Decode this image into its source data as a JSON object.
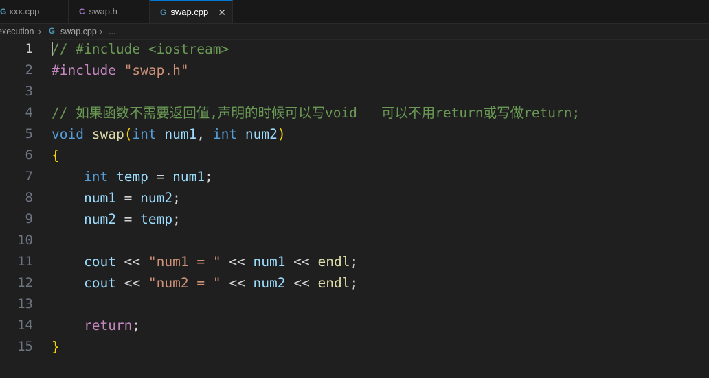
{
  "tabs": [
    {
      "label": "xxx.cpp",
      "icon": "cpp-file-icon",
      "icon_glyph": "G",
      "icon_color": "#519aba"
    },
    {
      "label": "swap.h",
      "icon": "c-header-file-icon",
      "icon_glyph": "C",
      "icon_color": "#a074c4"
    },
    {
      "label": "swap.cpp",
      "icon": "cpp-file-icon",
      "icon_glyph": "G",
      "icon_color": "#519aba",
      "active": true,
      "close_glyph": "✕"
    }
  ],
  "breadcrumb": {
    "folder": "execution",
    "file": "swap.cpp",
    "symbol": "...",
    "separator": "›",
    "file_icon_glyph": "G"
  },
  "editor": {
    "current_line": 1,
    "lines": [
      {
        "n": "1",
        "tokens": [
          {
            "t": "// #include <iostream>",
            "c": "comment"
          }
        ]
      },
      {
        "n": "2",
        "tokens": [
          {
            "t": "#include",
            "c": "pre"
          },
          {
            "t": " ",
            "c": "op"
          },
          {
            "t": "\"swap.h\"",
            "c": "str"
          }
        ]
      },
      {
        "n": "3",
        "tokens": []
      },
      {
        "n": "4",
        "tokens": [
          {
            "t": "// 如果函数不需要返回值,声明的时候可以写void   可以不用return或写做return;",
            "c": "comment"
          }
        ]
      },
      {
        "n": "5",
        "tokens": [
          {
            "t": "void",
            "c": "kw"
          },
          {
            "t": " ",
            "c": "op"
          },
          {
            "t": "swap",
            "c": "fn"
          },
          {
            "t": "(",
            "c": "br1"
          },
          {
            "t": "int",
            "c": "kw"
          },
          {
            "t": " ",
            "c": "op"
          },
          {
            "t": "num1",
            "c": "var"
          },
          {
            "t": ", ",
            "c": "op"
          },
          {
            "t": "int",
            "c": "kw"
          },
          {
            "t": " ",
            "c": "op"
          },
          {
            "t": "num2",
            "c": "var"
          },
          {
            "t": ")",
            "c": "br1"
          }
        ]
      },
      {
        "n": "6",
        "tokens": [
          {
            "t": "{",
            "c": "br1"
          }
        ]
      },
      {
        "n": "7",
        "tokens": [
          {
            "t": "    ",
            "c": "op"
          },
          {
            "t": "int",
            "c": "kw"
          },
          {
            "t": " ",
            "c": "op"
          },
          {
            "t": "temp",
            "c": "var"
          },
          {
            "t": " = ",
            "c": "op"
          },
          {
            "t": "num1",
            "c": "var"
          },
          {
            "t": ";",
            "c": "op"
          }
        ]
      },
      {
        "n": "8",
        "tokens": [
          {
            "t": "    ",
            "c": "op"
          },
          {
            "t": "num1",
            "c": "var"
          },
          {
            "t": " = ",
            "c": "op"
          },
          {
            "t": "num2",
            "c": "var"
          },
          {
            "t": ";",
            "c": "op"
          }
        ]
      },
      {
        "n": "9",
        "tokens": [
          {
            "t": "    ",
            "c": "op"
          },
          {
            "t": "num2",
            "c": "var"
          },
          {
            "t": " = ",
            "c": "op"
          },
          {
            "t": "temp",
            "c": "var"
          },
          {
            "t": ";",
            "c": "op"
          }
        ]
      },
      {
        "n": "10",
        "tokens": []
      },
      {
        "n": "11",
        "tokens": [
          {
            "t": "    ",
            "c": "op"
          },
          {
            "t": "cout",
            "c": "var"
          },
          {
            "t": " << ",
            "c": "op"
          },
          {
            "t": "\"num1 = \"",
            "c": "str"
          },
          {
            "t": " << ",
            "c": "op"
          },
          {
            "t": "num1",
            "c": "var"
          },
          {
            "t": " << ",
            "c": "op"
          },
          {
            "t": "endl",
            "c": "fn"
          },
          {
            "t": ";",
            "c": "op"
          }
        ]
      },
      {
        "n": "12",
        "tokens": [
          {
            "t": "    ",
            "c": "op"
          },
          {
            "t": "cout",
            "c": "var"
          },
          {
            "t": " << ",
            "c": "op"
          },
          {
            "t": "\"num2 = \"",
            "c": "str"
          },
          {
            "t": " << ",
            "c": "op"
          },
          {
            "t": "num2",
            "c": "var"
          },
          {
            "t": " << ",
            "c": "op"
          },
          {
            "t": "endl",
            "c": "fn"
          },
          {
            "t": ";",
            "c": "op"
          }
        ]
      },
      {
        "n": "13",
        "tokens": []
      },
      {
        "n": "14",
        "tokens": [
          {
            "t": "    ",
            "c": "op"
          },
          {
            "t": "return",
            "c": "ctrl"
          },
          {
            "t": ";",
            "c": "op"
          }
        ]
      },
      {
        "n": "15",
        "tokens": [
          {
            "t": "}",
            "c": "br1"
          }
        ]
      }
    ]
  }
}
